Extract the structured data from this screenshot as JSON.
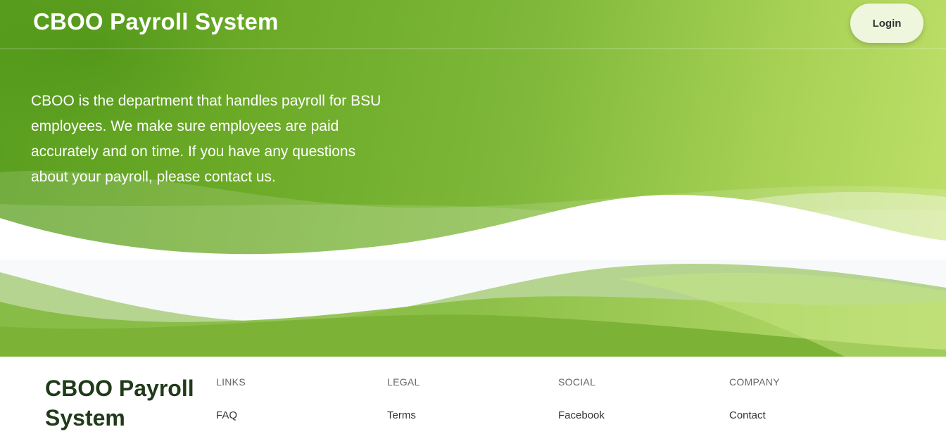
{
  "header": {
    "title": "CBOO Payroll System",
    "login_label": "Login"
  },
  "hero": {
    "description": "CBOO is the department that handles payroll for BSU employees. We make sure employees are paid accurately and on time. If you have any questions about your payroll, please contact us."
  },
  "footer": {
    "brand": "CBOO Payroll System",
    "columns": [
      {
        "heading": "LINKS",
        "link": "FAQ"
      },
      {
        "heading": "LEGAL",
        "link": "Terms"
      },
      {
        "heading": "SOCIAL",
        "link": "Facebook"
      },
      {
        "heading": "COMPANY",
        "link": "Contact"
      }
    ]
  },
  "colors": {
    "brand_green_dark": "#5a9e1f",
    "brand_green_light": "#bfe069",
    "login_bg": "#eef6dd",
    "footer_brand": "#203a1a"
  }
}
